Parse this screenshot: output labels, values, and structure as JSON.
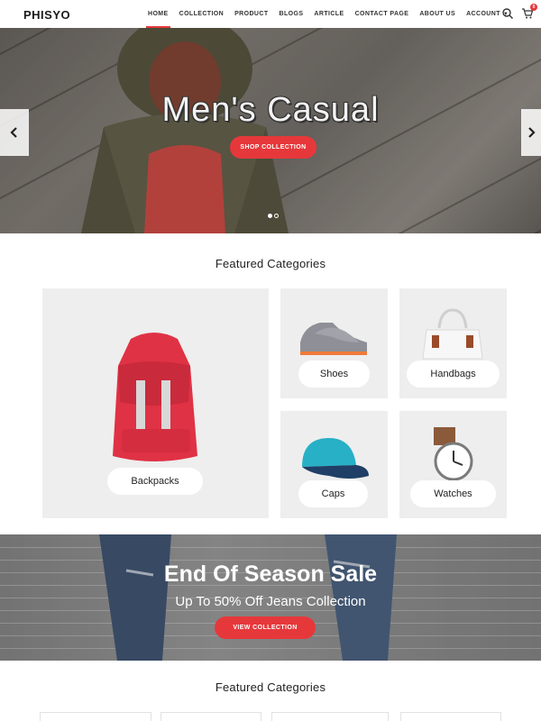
{
  "header": {
    "logo": "PHISYO",
    "nav": [
      {
        "label": "HOME",
        "active": true
      },
      {
        "label": "COLLECTION"
      },
      {
        "label": "PRODUCT"
      },
      {
        "label": "BLOGS"
      },
      {
        "label": "ARTICLE"
      },
      {
        "label": "CONTACT PAGE"
      },
      {
        "label": "ABOUT US"
      },
      {
        "label": "ACCOUNT"
      }
    ],
    "search_icon": "search-icon",
    "cart_icon": "cart-icon",
    "cart_count": "0"
  },
  "hero": {
    "title": "Men's Casual",
    "button_label": "SHOP COLLECTION",
    "slides": 2,
    "active_slide": 1
  },
  "featured": {
    "title": "Featured Categories",
    "categories": [
      {
        "label": "Backpacks",
        "icon": "backpack-icon"
      },
      {
        "label": "Shoes",
        "icon": "shoe-icon"
      },
      {
        "label": "Handbags",
        "icon": "handbag-icon"
      },
      {
        "label": "Caps",
        "icon": "cap-icon"
      },
      {
        "label": "Watches",
        "icon": "watch-icon"
      }
    ]
  },
  "sale": {
    "title": "End Of Season Sale",
    "subtitle": "Up To 50% Off Jeans Collection",
    "button_label": "VIEW COLLECTION"
  },
  "featured2": {
    "title": "Featured Categories"
  },
  "colors": {
    "accent": "#e6383b",
    "tile_bg": "#eeeeee"
  }
}
